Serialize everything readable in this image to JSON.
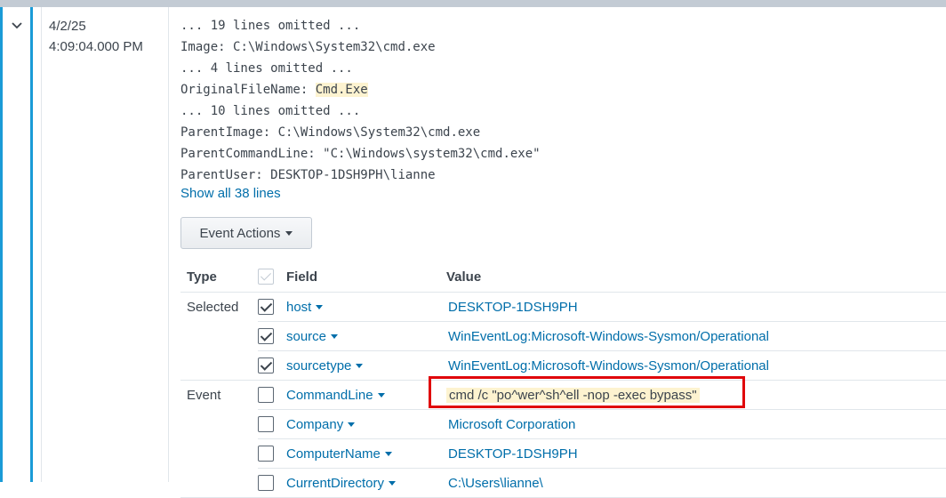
{
  "event": {
    "date": "4/2/25",
    "time": "4:09:04.000 PM",
    "raw_lines": [
      {
        "text": "... 19 lines omitted ..."
      },
      {
        "prefix": "Image: ",
        "text": "C:\\Windows\\System32\\cmd.exe"
      },
      {
        "text": "... 4 lines omitted ..."
      },
      {
        "prefix": "OriginalFileName: ",
        "highlight": "Cmd.Exe"
      },
      {
        "text": "... 10 lines omitted ..."
      },
      {
        "prefix": "ParentImage: ",
        "text": "C:\\Windows\\System32\\cmd.exe"
      },
      {
        "prefix": "ParentCommandLine: ",
        "text": "\"C:\\Windows\\system32\\cmd.exe\""
      },
      {
        "prefix": "ParentUser: ",
        "text": "DESKTOP-1DSH9PH\\lianne"
      }
    ],
    "show_all_label": "Show all 38 lines",
    "event_actions_label": "Event Actions"
  },
  "fields_table": {
    "headers": {
      "type": "Type",
      "field": "Field",
      "value": "Value"
    },
    "rows": [
      {
        "type": "Selected",
        "checked": true,
        "field": "host",
        "value": "DESKTOP-1DSH9PH"
      },
      {
        "type": "",
        "checked": true,
        "field": "source",
        "value": "WinEventLog:Microsoft-Windows-Sysmon/Operational"
      },
      {
        "type": "",
        "checked": true,
        "field": "sourcetype",
        "value": "WinEventLog:Microsoft-Windows-Sysmon/Operational"
      },
      {
        "type": "Event",
        "checked": false,
        "field": "CommandLine",
        "value": "cmd /c \"po^wer^sh^ell -nop -exec bypass\"",
        "highlighted": true
      },
      {
        "type": "",
        "checked": false,
        "field": "Company",
        "value": "Microsoft Corporation"
      },
      {
        "type": "",
        "checked": false,
        "field": "ComputerName",
        "value": "DESKTOP-1DSH9PH"
      },
      {
        "type": "",
        "checked": false,
        "field": "CurrentDirectory",
        "value": "C:\\Users\\lianne\\"
      }
    ]
  },
  "colors": {
    "link": "#006eaa",
    "highlight": "#fdf3d0",
    "annotation": "#e0060b",
    "expand_border": "#1a9bd7"
  }
}
